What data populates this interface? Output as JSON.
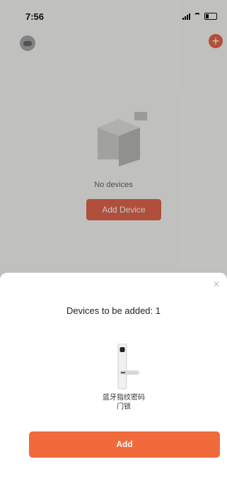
{
  "status_bar": {
    "time": "7:56",
    "location_icon": "location-arrow-icon"
  },
  "home": {
    "empty_text": "No devices",
    "add_device_label": "Add Device",
    "plus_icon": "+"
  },
  "sheet": {
    "title": "Devices to be added: 1",
    "close_icon": "×",
    "device_name": "蓝牙指纹密码\n门锁",
    "add_label": "Add"
  },
  "colors": {
    "accent": "#f06a3c",
    "accent_dim": "#e0664e"
  }
}
